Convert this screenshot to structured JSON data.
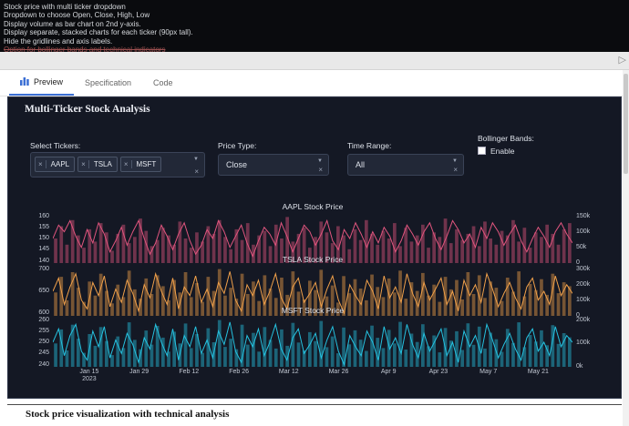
{
  "theme": {
    "accent": "#3b6fd4",
    "panel_bg": "#141824",
    "panel_border": "#2d3447"
  },
  "spec": {
    "lines": [
      "Stock price with multi ticker dropdown",
      "Dropdown to choose Open, Close, High, Low",
      "Display volume as bar chart on 2nd y-axis.",
      "Display separate, stacked charts for each ticker (90px tall).",
      "Hide the gridlines and axis labels."
    ],
    "struck_line": "Option for bollinger bands and technical indicators"
  },
  "toolbar": {
    "run_icon": "▷"
  },
  "tabs": [
    {
      "label": "Preview",
      "active": true
    },
    {
      "label": "Specification",
      "active": false
    },
    {
      "label": "Code",
      "active": false
    }
  ],
  "panel": {
    "title": "Multi-Ticker Stock Analysis",
    "controls": {
      "tickers": {
        "label": "Select Tickers:",
        "chips": [
          "AAPL",
          "TSLA",
          "MSFT"
        ],
        "remove_icon": "×",
        "caret_icon": "▼",
        "clear_icon": "×"
      },
      "price_type": {
        "label": "Price Type:",
        "value": "Close",
        "caret_icon": "▼",
        "clear_icon": "×"
      },
      "time_range": {
        "label": "Time Range:",
        "value": "All",
        "caret_icon": "▼",
        "clear_icon": "×"
      },
      "bollinger": {
        "label": "Bollinger Bands:",
        "option": "Enable",
        "checked": false
      }
    }
  },
  "chart_data": {
    "type": "line+bar stacked small multiples",
    "x_ticks": [
      {
        "label": "Jan 15",
        "sub": "2023"
      },
      {
        "label": "Jan 29"
      },
      {
        "label": "Feb 12"
      },
      {
        "label": "Feb 26"
      },
      {
        "label": "Mar 12"
      },
      {
        "label": "Mar 26"
      },
      {
        "label": "Apr 9"
      },
      {
        "label": "Apr 23"
      },
      {
        "label": "May 7"
      },
      {
        "label": "May 21"
      }
    ],
    "charts": [
      {
        "ticker": "AAPL",
        "title": "AAPL Stock Price",
        "line_color": "#e0557e",
        "bar_color": "rgba(224,85,126,0.45)",
        "ylim": [
          139,
          161
        ],
        "y_ticks": [
          160,
          155,
          150,
          145,
          140
        ],
        "vol_max": 160,
        "y2_ticks": [
          {
            "v": 150,
            "label": "150k"
          },
          {
            "v": 100,
            "label": "100k"
          },
          {
            "v": 50,
            "label": "50k"
          },
          {
            "v": 0,
            "label": "0"
          }
        ],
        "prices": [
          150,
          156,
          153,
          158,
          151,
          146,
          154,
          148,
          157,
          152,
          144,
          149,
          155,
          147,
          153,
          158,
          150,
          143,
          148,
          156,
          151,
          145,
          152,
          157,
          149,
          143,
          147,
          154,
          150,
          158,
          153,
          146,
          151,
          156,
          148,
          142,
          149,
          155,
          152,
          147,
          157,
          151,
          144,
          150,
          156,
          153,
          147,
          152,
          158,
          149,
          145,
          154,
          150,
          157,
          152,
          146,
          153,
          148,
          155,
          151,
          144,
          149,
          156,
          152,
          147,
          153,
          157,
          150,
          145,
          151,
          158,
          154,
          148,
          152,
          146,
          155,
          150,
          157,
          153,
          147,
          152,
          156,
          149,
          144,
          150,
          155,
          151,
          146,
          153,
          157,
          152,
          148
        ],
        "volumes": [
          80,
          120,
          60,
          140,
          90,
          50,
          110,
          70,
          130,
          100,
          40,
          95,
          125,
          65,
          85,
          145,
          105,
          55,
          75,
          115,
          90,
          60,
          135,
          80,
          50,
          100,
          70,
          120,
          95,
          140,
          85,
          45,
          110,
          75,
          130,
          60,
          90,
          105,
          55,
          125,
          80,
          150,
          70,
          95,
          115,
          50,
          85,
          135,
          100,
          65,
          120,
          90,
          45,
          110,
          75,
          140,
          95,
          60,
          105,
          80,
          130,
          55,
          115,
          70,
          90,
          125,
          50,
          100,
          85,
          145,
          65,
          110,
          75,
          95,
          120,
          55,
          135,
          80,
          60,
          105,
          90,
          140,
          70,
          115,
          50,
          100,
          85,
          125,
          95,
          60,
          110,
          130
        ]
      },
      {
        "ticker": "TSLA",
        "title": "TSLA Stock Price",
        "line_color": "#f0a04a",
        "bar_color": "rgba(240,160,74,0.45)",
        "ylim": [
          594,
          706
        ],
        "y_ticks": [
          700,
          650,
          600
        ],
        "vol_max": 315,
        "y2_ticks": [
          {
            "v": 300,
            "label": "300k"
          },
          {
            "v": 200,
            "label": "200k"
          },
          {
            "v": 100,
            "label": "100k"
          },
          {
            "v": 0,
            "label": "0"
          }
        ],
        "prices": [
          650,
          680,
          620,
          660,
          690,
          630,
          610,
          670,
          640,
          685,
          615,
          655,
          625,
          675,
          645,
          605,
          665,
          635,
          690,
          650,
          620,
          680,
          610,
          660,
          640,
          685,
          625,
          655,
          615,
          670,
          645,
          695,
          630,
          605,
          665,
          640,
          675,
          620,
          650,
          690,
          635,
          610,
          660,
          680,
          625,
          645,
          670,
          615,
          655,
          685,
          630,
          600,
          665,
          640,
          620,
          675,
          650,
          610,
          685,
          635,
          660,
          625,
          690,
          645,
          615,
          670,
          630,
          655,
          680,
          620,
          650,
          605,
          675,
          640,
          665,
          625,
          690,
          655,
          615,
          645,
          670,
          635,
          610,
          660,
          680,
          630,
          650,
          620,
          685,
          640,
          665,
          645
        ],
        "volumes": [
          150,
          250,
          100,
          280,
          180,
          90,
          220,
          130,
          270,
          160,
          80,
          200,
          120,
          290,
          170,
          110,
          240,
          140,
          260,
          190,
          100,
          230,
          150,
          280,
          120,
          210,
          90,
          250,
          160,
          300,
          130,
          180,
          110,
          270,
          140,
          220,
          95,
          260,
          175,
          115,
          245,
          135,
          285,
          155,
          105,
          225,
          165,
          295,
          125,
          195,
          85,
          255,
          145,
          235,
          175,
          100,
          265,
          185,
          120,
          240,
          150,
          290,
          110,
          215,
          160,
          275,
          130,
          200,
          90,
          250,
          170,
          230,
          105,
          280,
          140,
          260,
          115,
          220,
          180,
          95,
          245,
          155,
          285,
          125,
          205,
          165,
          235,
          135,
          270,
          145,
          215,
          190
        ]
      },
      {
        "ticker": "MSFT",
        "title": "MSFT Stock Price",
        "line_color": "#25c2e0",
        "bar_color": "rgba(37,194,224,0.45)",
        "ylim": [
          239,
          261
        ],
        "y_ticks": [
          260,
          255,
          250,
          245,
          240
        ],
        "vol_max": 210,
        "y2_ticks": [
          {
            "v": 200,
            "label": "200k"
          },
          {
            "v": 100,
            "label": "100k"
          },
          {
            "v": 0,
            "label": "0k"
          }
        ],
        "prices": [
          250,
          256,
          244,
          253,
          258,
          246,
          242,
          255,
          248,
          257,
          243,
          251,
          245,
          254,
          249,
          241,
          252,
          247,
          258,
          250,
          244,
          256,
          242,
          253,
          248,
          257,
          245,
          251,
          243,
          255,
          249,
          259,
          246,
          241,
          253,
          248,
          256,
          244,
          250,
          258,
          247,
          242,
          252,
          256,
          245,
          249,
          254,
          243,
          251,
          257,
          246,
          240,
          253,
          248,
          244,
          255,
          250,
          242,
          257,
          247,
          252,
          245,
          258,
          249,
          243,
          254,
          246,
          251,
          256,
          244,
          250,
          241,
          255,
          248,
          253,
          245,
          258,
          251,
          243,
          249,
          254,
          247,
          242,
          252,
          256,
          246,
          250,
          244,
          257,
          248,
          253,
          250
        ],
        "volumes": [
          100,
          160,
          70,
          180,
          120,
          60,
          140,
          90,
          170,
          110,
          50,
          130,
          80,
          190,
          115,
          75,
          155,
          95,
          175,
          125,
          65,
          150,
          100,
          185,
          80,
          140,
          60,
          165,
          105,
          200,
          85,
          120,
          75,
          180,
          95,
          145,
          65,
          170,
          115,
          78,
          160,
          90,
          188,
          104,
          70,
          148,
          110,
          196,
          84,
          130,
          58,
          168,
          96,
          156,
          116,
          68,
          176,
          124,
          80,
          158,
          100,
          192,
          74,
          142,
          106,
          182,
          88,
          134,
          62,
          166,
          112,
          152,
          72,
          186,
          94,
          172,
          78,
          146,
          118,
          64,
          162,
          102,
          190,
          84,
          136,
          108,
          156,
          92,
          178,
          98,
          144,
          126
        ]
      }
    ]
  },
  "footer": {
    "title": "Stock price visualization with technical analysis"
  }
}
